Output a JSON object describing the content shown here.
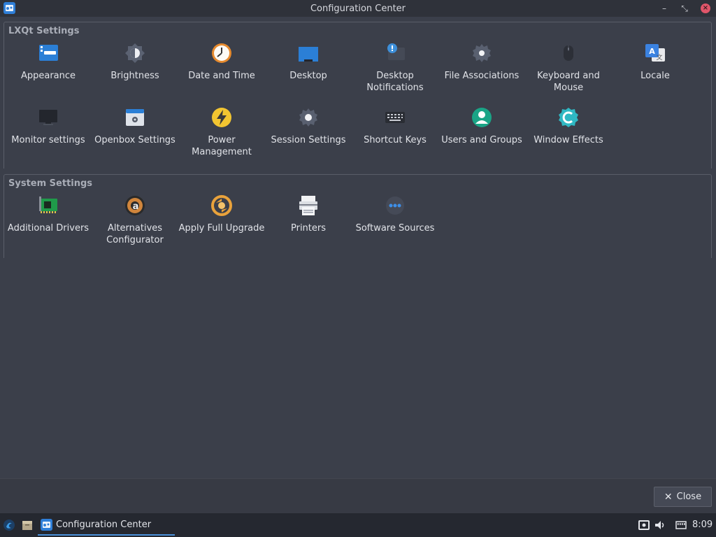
{
  "window": {
    "title": "Configuration Center",
    "min_glyph": "–",
    "max_glyph": "⤡",
    "close_glyph": "×"
  },
  "groups": {
    "lxqt": {
      "title": "LXQt Settings",
      "items": [
        {
          "label": "Appearance",
          "icon": "appearance-icon"
        },
        {
          "label": "Brightness",
          "icon": "brightness-icon"
        },
        {
          "label": "Date and Time",
          "icon": "clock-icon"
        },
        {
          "label": "Desktop",
          "icon": "desktop-icon"
        },
        {
          "label": "Desktop Notifications",
          "icon": "notification-icon"
        },
        {
          "label": "File Associations",
          "icon": "gear-icon"
        },
        {
          "label": "Keyboard and Mouse",
          "icon": "mouse-icon"
        },
        {
          "label": "Locale",
          "icon": "translate-icon"
        },
        {
          "label": "Monitor settings",
          "icon": "monitor-icon"
        },
        {
          "label": "Openbox Settings",
          "icon": "openbox-icon"
        },
        {
          "label": "Power Management",
          "icon": "power-icon"
        },
        {
          "label": "Session Settings",
          "icon": "gear-icon"
        },
        {
          "label": "Shortcut Keys",
          "icon": "keyboard-icon"
        },
        {
          "label": "Users and Groups",
          "icon": "user-icon"
        },
        {
          "label": "Window Effects",
          "icon": "compton-icon"
        }
      ]
    },
    "system": {
      "title": "System Settings",
      "items": [
        {
          "label": "Additional Drivers",
          "icon": "chip-icon"
        },
        {
          "label": "Alternatives Configurator",
          "icon": "alternatives-icon"
        },
        {
          "label": "Apply Full Upgrade",
          "icon": "upgrade-icon"
        },
        {
          "label": "Printers",
          "icon": "printer-icon"
        },
        {
          "label": "Software Sources",
          "icon": "software-sources-icon"
        }
      ]
    }
  },
  "footer": {
    "close_label": "Close"
  },
  "taskbar": {
    "task_title": "Configuration Center",
    "clock": "8:09"
  },
  "colors": {
    "background": "#3b3f4a",
    "accent": "#4a90d9",
    "close": "#e0566a"
  }
}
